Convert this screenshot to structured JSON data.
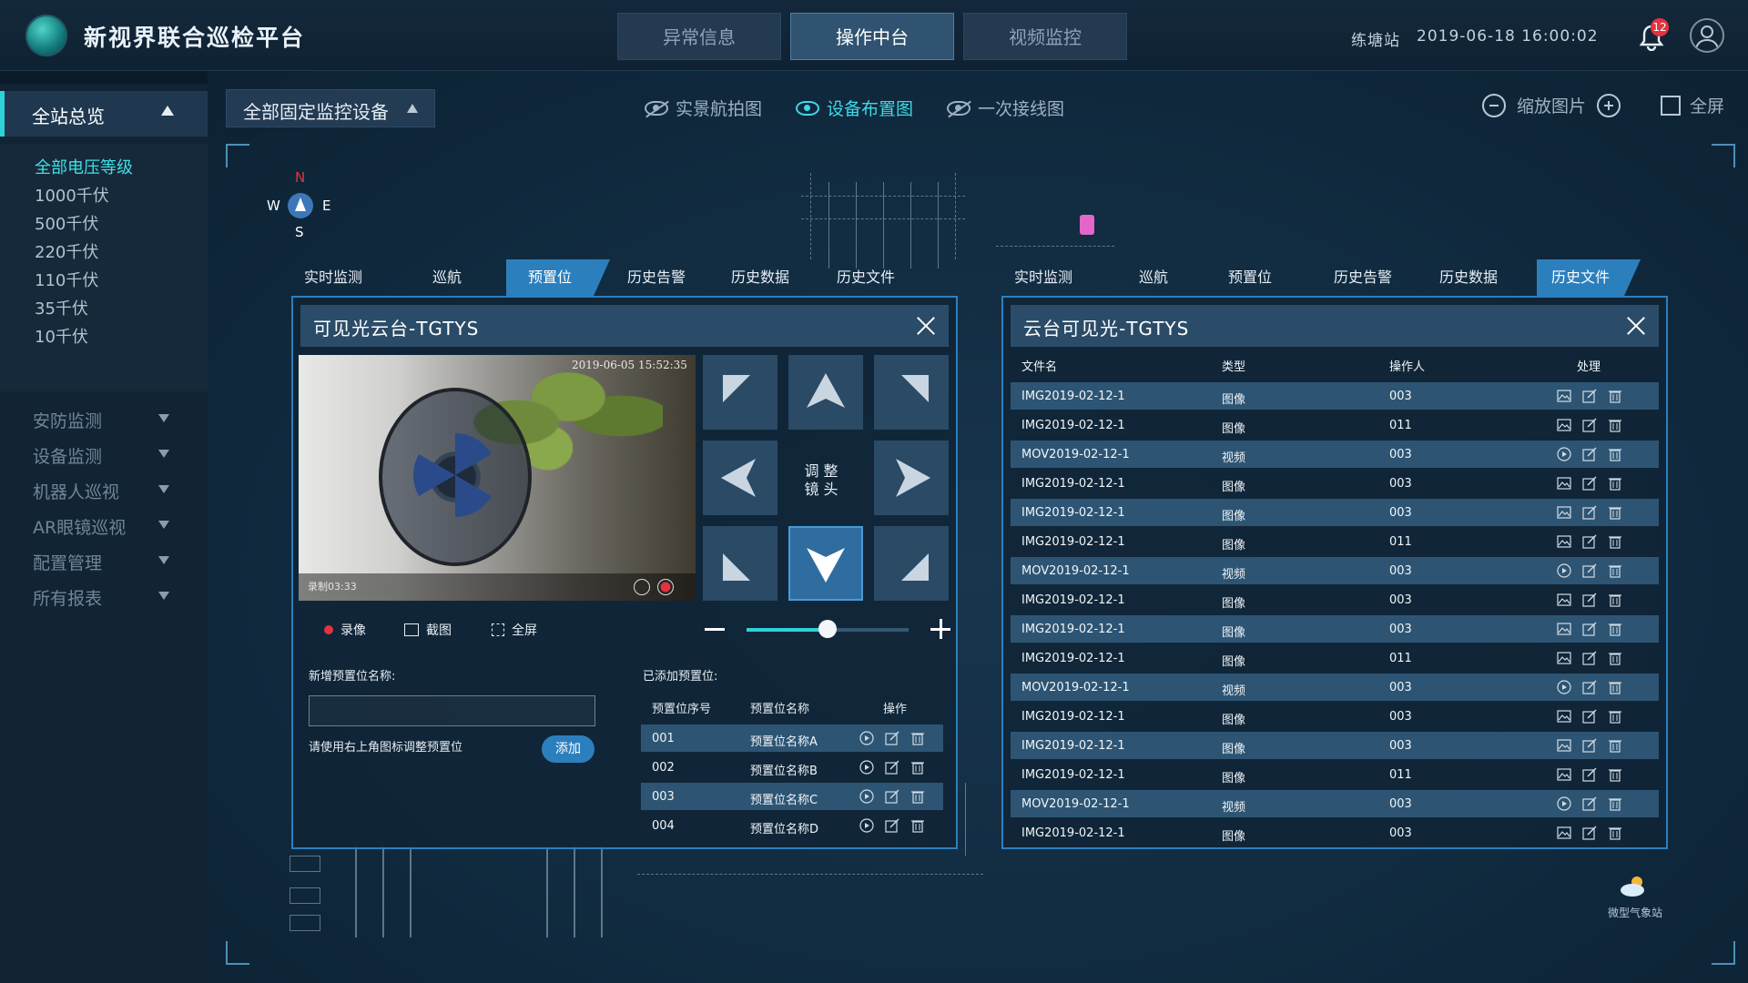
{
  "header": {
    "title": "新视界联合巡检平台",
    "tabs": [
      {
        "label": "异常信息"
      },
      {
        "label": "操作中台"
      },
      {
        "label": "视频监控"
      }
    ],
    "active_tab": 1,
    "station": "练塘站",
    "datetime": "2019-06-18   16:00:02",
    "notification_count": "12"
  },
  "sidebar": {
    "section": "全站总览",
    "voltages": [
      "全部电压等级",
      "1000千伏",
      "500千伏",
      "220千伏",
      "110千伏",
      "35千伏",
      "10千伏"
    ],
    "items": [
      "安防监测",
      "设备监测",
      "机器人巡视",
      "AR眼镜巡视",
      "配置管理",
      "所有报表"
    ]
  },
  "toolbar": {
    "filter": "全部固定监控设备",
    "views": [
      {
        "label": "实景航拍图"
      },
      {
        "label": "设备布置图"
      },
      {
        "label": "一次接线图"
      }
    ],
    "active_view": 1,
    "zoom_label": "缩放图片",
    "fullscreen_label": "全屏"
  },
  "compass": {
    "n": "N",
    "s": "S",
    "e": "E",
    "w": "W"
  },
  "left_tabs": [
    "实时监测",
    "巡航",
    "预置位",
    "历史告警",
    "历史数据",
    "历史文件"
  ],
  "left_active": 2,
  "right_tabs": [
    "实时监测",
    "巡航",
    "预置位",
    "历史告警",
    "历史数据",
    "历史文件"
  ],
  "right_active": 5,
  "camera_panel": {
    "title": "可见光云台-TGTYS",
    "timestamp": "2019-06-05 15:52:35",
    "recording": "录制03:33",
    "ptz_label_1": "调 整",
    "ptz_label_2": "镜 头",
    "controls": {
      "record": "录像",
      "snapshot": "截图",
      "fullscreen": "全屏"
    },
    "zoom_level": 0.5,
    "new_preset_label": "新增预置位名称:",
    "hint": "请使用右上角图标调整预置位",
    "add_button": "添加",
    "added_label": "已添加预置位:",
    "preset_headers": [
      "预置位序号",
      "预置位名称",
      "操作"
    ],
    "presets": [
      {
        "no": "001",
        "name": "预置位名称A"
      },
      {
        "no": "002",
        "name": "预置位名称B"
      },
      {
        "no": "003",
        "name": "预置位名称C"
      },
      {
        "no": "004",
        "name": "预置位名称D"
      }
    ]
  },
  "file_panel": {
    "title": "云台可见光-TGTYS",
    "headers": [
      "文件名",
      "类型",
      "操作人",
      "处理"
    ],
    "files": [
      {
        "name": "IMG2019-02-12-1",
        "type": "图像",
        "op": "003"
      },
      {
        "name": "IMG2019-02-12-1",
        "type": "图像",
        "op": "011"
      },
      {
        "name": "MOV2019-02-12-1",
        "type": "视频",
        "op": "003"
      },
      {
        "name": "IMG2019-02-12-1",
        "type": "图像",
        "op": "003"
      },
      {
        "name": "IMG2019-02-12-1",
        "type": "图像",
        "op": "003"
      },
      {
        "name": "IMG2019-02-12-1",
        "type": "图像",
        "op": "011"
      },
      {
        "name": "MOV2019-02-12-1",
        "type": "视频",
        "op": "003"
      },
      {
        "name": "IMG2019-02-12-1",
        "type": "图像",
        "op": "003"
      },
      {
        "name": "IMG2019-02-12-1",
        "type": "图像",
        "op": "003"
      },
      {
        "name": "IMG2019-02-12-1",
        "type": "图像",
        "op": "011"
      },
      {
        "name": "MOV2019-02-12-1",
        "type": "视频",
        "op": "003"
      },
      {
        "name": "IMG2019-02-12-1",
        "type": "图像",
        "op": "003"
      },
      {
        "name": "IMG2019-02-12-1",
        "type": "图像",
        "op": "003"
      },
      {
        "name": "IMG2019-02-12-1",
        "type": "图像",
        "op": "011"
      },
      {
        "name": "MOV2019-02-12-1",
        "type": "视频",
        "op": "003"
      },
      {
        "name": "IMG2019-02-12-1",
        "type": "图像",
        "op": "003"
      }
    ]
  },
  "weather_label": "微型气象站",
  "colors": {
    "accent": "#2c7fbd",
    "cyan": "#2fd1d8",
    "highlight_row": "#2d5573",
    "alert": "#e5323f"
  }
}
